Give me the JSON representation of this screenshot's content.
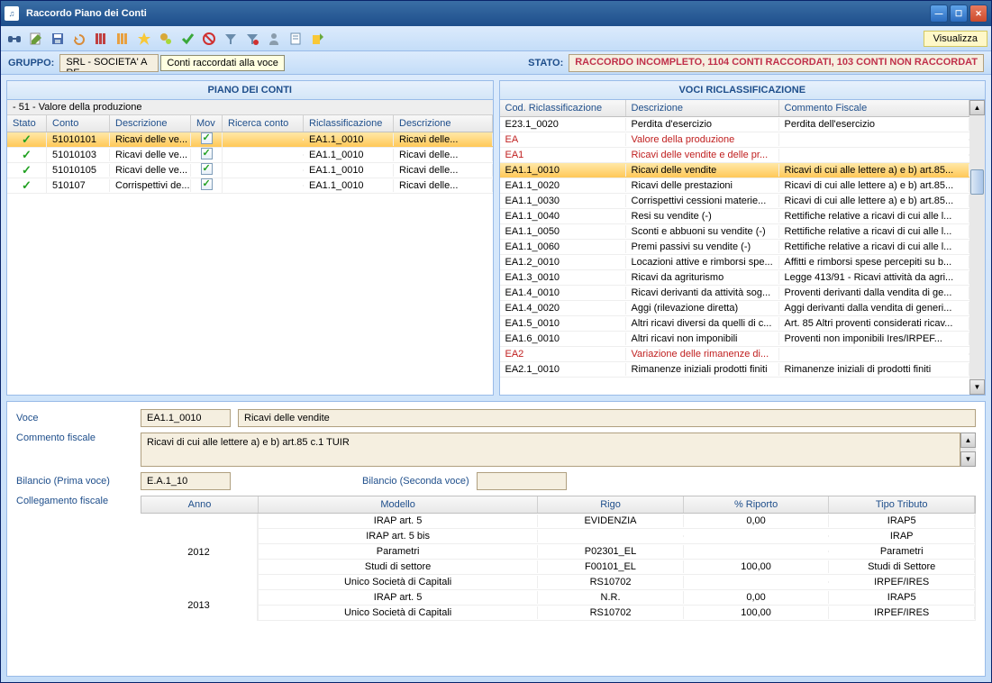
{
  "window": {
    "title": "Raccordo Piano dei Conti"
  },
  "toolbar": {
    "visualizza": "Visualizza"
  },
  "infobar": {
    "gruppo_label": "GRUPPO:",
    "gruppo_value": "SRL - SOCIETA' A RE",
    "tooltip": "Conti raccordati alla voce",
    "stato_label": "STATO:",
    "stato_value": "RACCORDO INCOMPLETO, 1104 CONTI RACCORDATI, 103 CONTI NON RACCORDAT"
  },
  "panels": {
    "left": "PIANO DEI CONTI",
    "right": "VOCI RICLASSIFICAZIONE"
  },
  "piano": {
    "tree_node": "- 51 - Valore della produzione",
    "headers": {
      "stato": "Stato",
      "conto": "Conto",
      "descrizione": "Descrizione",
      "mov": "Mov",
      "ricerca": "Ricerca conto",
      "riclass": "Riclassificazione",
      "descr2": "Descrizione"
    },
    "rows": [
      {
        "conto": "51010101",
        "descr": "Ricavi delle ve...",
        "riclass": "EA1.1_0010",
        "descr2": "Ricavi delle..."
      },
      {
        "conto": "51010103",
        "descr": "Ricavi delle ve...",
        "riclass": "EA1.1_0010",
        "descr2": "Ricavi delle..."
      },
      {
        "conto": "51010105",
        "descr": "Ricavi delle ve...",
        "riclass": "EA1.1_0010",
        "descr2": "Ricavi delle..."
      },
      {
        "conto": "510107",
        "descr": "Corrispettivi de...",
        "riclass": "EA1.1_0010",
        "descr2": "Ricavi delle..."
      }
    ]
  },
  "voci": {
    "headers": {
      "cod": "Cod. Riclassificazione",
      "descr": "Descrizione",
      "comm": "Commento Fiscale"
    },
    "rows": [
      {
        "cod": "E23.1_0020",
        "descr": "Perdita d'esercizio",
        "comm": "Perdita dell'esercizio",
        "red": false
      },
      {
        "cod": "EA",
        "descr": "Valore della produzione",
        "comm": "",
        "red": true
      },
      {
        "cod": "EA1",
        "descr": "Ricavi delle vendite e delle pr...",
        "comm": "",
        "red": true
      },
      {
        "cod": "EA1.1_0010",
        "descr": "Ricavi delle vendite",
        "comm": "Ricavi di cui alle lettere a) e b) art.85...",
        "sel": true
      },
      {
        "cod": "EA1.1_0020",
        "descr": "Ricavi delle prestazioni",
        "comm": "Ricavi di cui alle lettere a) e b) art.85..."
      },
      {
        "cod": "EA1.1_0030",
        "descr": "Corrispettivi cessioni materie...",
        "comm": "Ricavi di cui alle lettere a) e b) art.85..."
      },
      {
        "cod": "EA1.1_0040",
        "descr": "Resi su vendite (-)",
        "comm": "Rettifiche relative a ricavi di cui alle l..."
      },
      {
        "cod": "EA1.1_0050",
        "descr": "Sconti e abbuoni su vendite (-)",
        "comm": "Rettifiche relative a ricavi di cui alle l..."
      },
      {
        "cod": "EA1.1_0060",
        "descr": "Premi passivi su vendite (-)",
        "comm": "Rettifiche relative a ricavi di cui alle l..."
      },
      {
        "cod": "EA1.2_0010",
        "descr": "Locazioni attive e rimborsi spe...",
        "comm": "Affitti e rimborsi spese percepiti su b..."
      },
      {
        "cod": "EA1.3_0010",
        "descr": "Ricavi da agriturismo",
        "comm": "Legge 413/91 - Ricavi attività da agri..."
      },
      {
        "cod": "EA1.4_0010",
        "descr": "Ricavi derivanti da attività sog...",
        "comm": "Proventi derivanti dalla vendita di ge..."
      },
      {
        "cod": "EA1.4_0020",
        "descr": "Aggi (rilevazione diretta)",
        "comm": "Aggi derivanti dalla vendita di generi..."
      },
      {
        "cod": "EA1.5_0010",
        "descr": "Altri ricavi diversi da quelli di c...",
        "comm": "Art. 85 Altri proventi considerati ricav..."
      },
      {
        "cod": "EA1.6_0010",
        "descr": "Altri ricavi non imponibili",
        "comm": "Proventi non imponibili Ires/IRPEF..."
      },
      {
        "cod": "EA2",
        "descr": "Variazione delle rimanenze di...",
        "comm": "",
        "red": true
      },
      {
        "cod": "EA2.1_0010",
        "descr": "Rimanenze iniziali prodotti finiti",
        "comm": "Rimanenze iniziali di prodotti finiti"
      }
    ]
  },
  "form": {
    "voce_label": "Voce",
    "voce_code": "EA1.1_0010",
    "voce_descr": "Ricavi delle vendite",
    "commento_label": "Commento fiscale",
    "commento_value": "Ricavi di cui alle lettere a) e b) art.85 c.1 TUIR",
    "bilancio1_label": "Bilancio (Prima voce)",
    "bilancio1_value": "E.A.1_10",
    "bilancio2_label": "Bilancio (Seconda voce)",
    "bilancio2_value": "",
    "link_label": "Collegamento fiscale"
  },
  "link_table": {
    "headers": {
      "anno": "Anno",
      "modello": "Modello",
      "rigo": "Rigo",
      "riporto": "% Riporto",
      "tributo": "Tipo Tributo"
    },
    "groups": [
      {
        "anno": "2012",
        "rows": [
          {
            "modello": "IRAP art. 5",
            "rigo": "EVIDENZIA",
            "riporto": "0,00",
            "tributo": "IRAP5"
          },
          {
            "modello": "IRAP art. 5 bis",
            "rigo": "",
            "riporto": "",
            "tributo": "IRAP"
          },
          {
            "modello": "Parametri",
            "rigo": "P02301_EL",
            "riporto": "",
            "tributo": "Parametri"
          },
          {
            "modello": "Studi di settore",
            "rigo": "F00101_EL",
            "riporto": "100,00",
            "tributo": "Studi di Settore"
          },
          {
            "modello": "Unico Società di Capitali",
            "rigo": "RS10702",
            "riporto": "",
            "tributo": "IRPEF/IRES"
          }
        ]
      },
      {
        "anno": "2013",
        "rows": [
          {
            "modello": "IRAP art. 5",
            "rigo": "N.R.",
            "riporto": "0,00",
            "tributo": "IRAP5"
          },
          {
            "modello": "Unico Società di Capitali",
            "rigo": "RS10702",
            "riporto": "100,00",
            "tributo": "IRPEF/IRES"
          }
        ]
      }
    ]
  }
}
